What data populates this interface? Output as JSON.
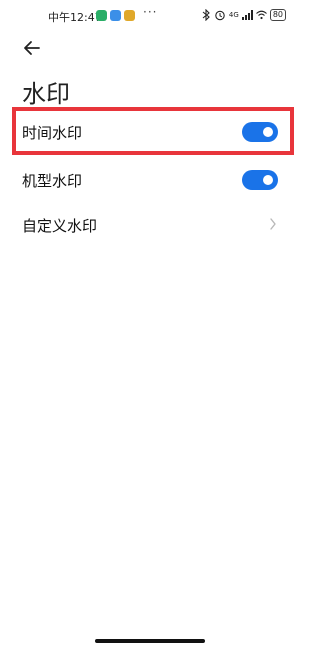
{
  "status_bar": {
    "time": "中午12:47",
    "network": "4G",
    "battery": "80",
    "more": "···",
    "app_icon_colors": [
      "#2aae67",
      "#3b8fe8",
      "#e0a82a"
    ]
  },
  "header": {
    "back_icon": "arrow-left-icon",
    "title": "水印"
  },
  "settings": {
    "items": [
      {
        "label": "时间水印",
        "control": "toggle",
        "on": true
      },
      {
        "label": "机型水印",
        "control": "toggle",
        "on": true
      },
      {
        "label": "自定义水印",
        "control": "chevron"
      }
    ]
  },
  "colors": {
    "accent": "#1a73e8",
    "highlight": "#e8353b"
  }
}
